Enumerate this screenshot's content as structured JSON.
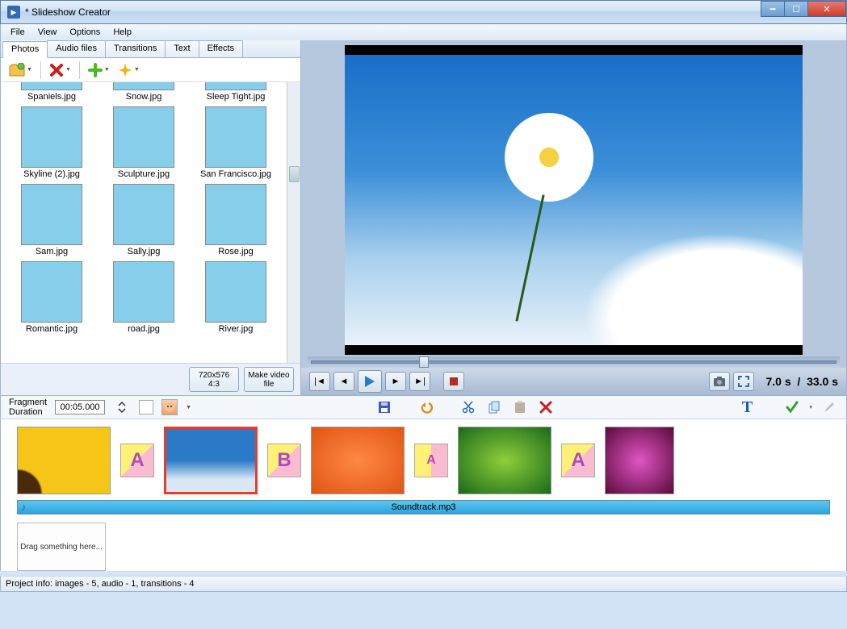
{
  "window": {
    "title": "* Slideshow Creator"
  },
  "menu": {
    "file": "File",
    "view": "View",
    "options": "Options",
    "help": "Help"
  },
  "tabs": {
    "photos": "Photos",
    "audio": "Audio files",
    "transitions": "Transitions",
    "text": "Text",
    "effects": "Effects"
  },
  "thumbs": {
    "row0": [
      "Spaniels.jpg",
      "Snow.jpg",
      "Sleep Tight.jpg"
    ],
    "row1": [
      "Skyline (2).jpg",
      "Sculpture.jpg",
      "San Francisco.jpg"
    ],
    "row2": [
      "Sam.jpg",
      "Sally.jpg",
      "Rose.jpg"
    ],
    "row3": [
      "Romantic.jpg",
      "road.jpg",
      "River.jpg"
    ]
  },
  "leftBottom": {
    "res1": "720x576",
    "res2": "4:3",
    "make": "Make video file"
  },
  "playback": {
    "time_current": "7.0 s",
    "time_sep": "/",
    "time_total": "33.0 s"
  },
  "fragment": {
    "label1": "Fragment",
    "label2": "Duration",
    "value": "00:05.000"
  },
  "audio": {
    "track": "Soundtrack.mp3"
  },
  "dropzone": {
    "text": "Drag something here..."
  },
  "status": {
    "text": "Project info: images - 5, audio - 1, transitions - 4"
  },
  "trans_labels": {
    "a": "A",
    "b": "B"
  }
}
